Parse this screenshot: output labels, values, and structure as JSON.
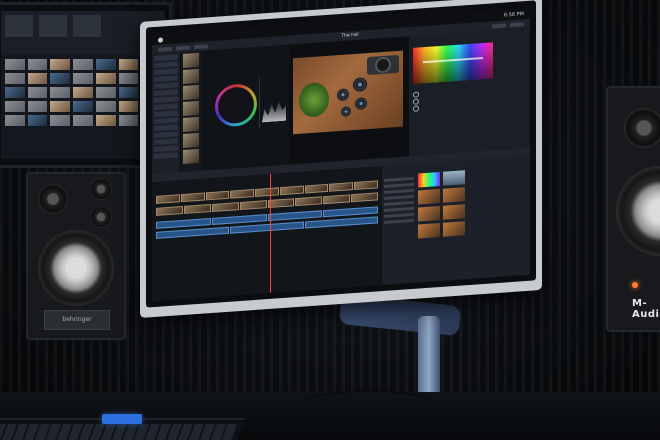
{
  "scene": {
    "description_colors": {
      "wall": "#0c0f13",
      "monitor_frame": "#c7cbd0",
      "accent": "#2c6fe0"
    }
  },
  "main_app": {
    "project_title": "The Fall",
    "time": "6:56 PM"
  },
  "right_speaker": {
    "brand": "M-Audio"
  },
  "left_speaker": {
    "brand": "behringer"
  }
}
